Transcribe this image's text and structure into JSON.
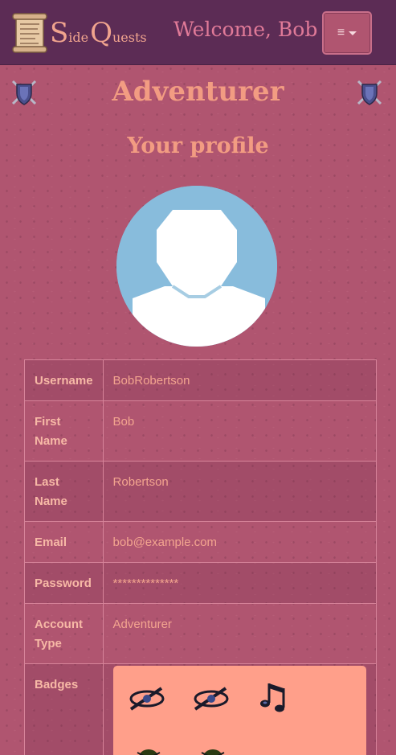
{
  "navbar": {
    "brand": {
      "s": "S",
      "ide": "ide",
      "q": "Q",
      "uests": "uests"
    },
    "welcome": "Welcome, Bob",
    "menu_icon": "≡",
    "logo_icon": "scroll-icon"
  },
  "header": {
    "title": "Adventurer",
    "subtitle": "Your profile",
    "left_icon": "shield-swords-icon",
    "right_icon": "shield-swords-icon"
  },
  "profile": {
    "username_label": "Username",
    "username": "BobRobertson",
    "first_name_label": "First Name",
    "first_name": "Bob",
    "last_name_label": "Last Name",
    "last_name": "Robertson",
    "email_label": "Email",
    "email": "bob@example.com",
    "password_label": "Password",
    "password": "**************",
    "account_type_label": "Account Type",
    "account_type": "Adventurer",
    "badges_label": "Badges",
    "badges": [
      "eye-badge-icon",
      "eye-badge-icon",
      "music-note-badge-icon",
      "bug-badge-icon",
      "bug-badge-icon"
    ]
  },
  "colors": {
    "navbar": "#5c2c55",
    "background": "#b05570",
    "accent": "#f29c82",
    "badge_panel": "#ff9f8a"
  }
}
